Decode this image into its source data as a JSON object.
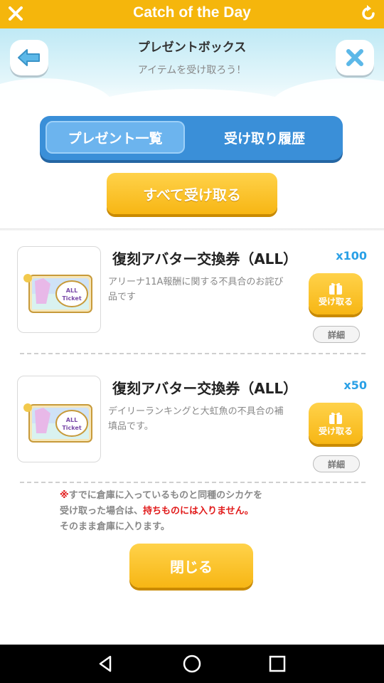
{
  "app": {
    "title": "Catch of the Day"
  },
  "header": {
    "title": "プレゼントボックス",
    "subtitle": "アイテムを受け取ろう！"
  },
  "tabs": [
    {
      "label": "プレゼント一覧",
      "active": true
    },
    {
      "label": "受け取り履歴",
      "active": false
    }
  ],
  "claim_all_label": "すべて受け取る",
  "items": [
    {
      "name": "復刻アバター交換券（ALL）",
      "quantity": "x100",
      "description": "アリーナ11A報酬に関する不具合のお詫び品です",
      "ticket_text_1": "ALL",
      "ticket_text_2": "Ticket",
      "receive_label": "受け取る",
      "detail_label": "詳細"
    },
    {
      "name": "復刻アバター交換券（ALL）",
      "quantity": "x50",
      "description": "デイリーランキングと大虹魚の不具合の補填品です。",
      "ticket_text_1": "ALL",
      "ticket_text_2": "Ticket",
      "receive_label": "受け取る",
      "detail_label": "詳細"
    }
  ],
  "notice": {
    "mark": "※",
    "line1": "すでに倉庫に入っているものと同種のシカケを",
    "line2_prefix": "受け取った場合は、",
    "line2_emphasis": "持ちものには入りません。",
    "line3": "そのまま倉庫に入ります。"
  },
  "close_label": "閉じる",
  "colors": {
    "accent_yellow": "#f5b60c",
    "tab_blue": "#3a8fd8",
    "qty_blue": "#2aa0e6",
    "warning_red": "#e11a1a"
  },
  "icons": {
    "topbar_left": "close-icon",
    "topbar_right": "reload-icon",
    "header_left": "back-arrow-icon",
    "header_right": "close-icon",
    "receive": "gift-icon",
    "nav": [
      "back-triangle-icon",
      "home-circle-icon",
      "recents-square-icon"
    ]
  }
}
